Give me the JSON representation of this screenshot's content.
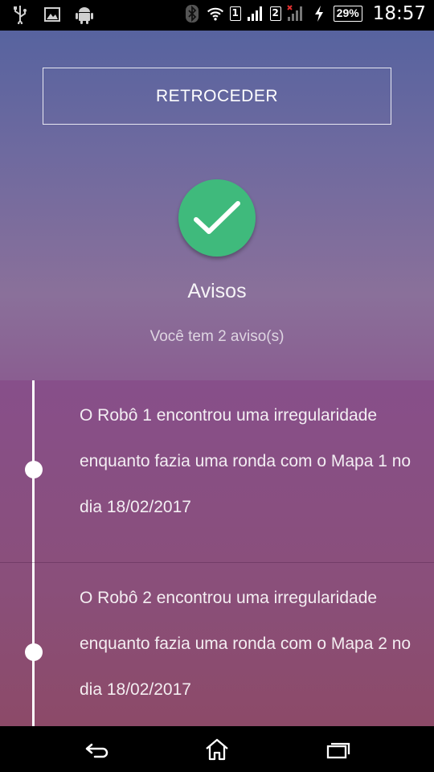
{
  "status_bar": {
    "sim1": "1",
    "sim2": "2",
    "battery": "29%",
    "time": "18:57"
  },
  "app": {
    "back_label": "RETROCEDER",
    "title": "Avisos",
    "subtitle": "Você tem 2 aviso(s)",
    "notices": [
      {
        "text": "O Robô 1 encontrou uma irregularidade enquanto fazia uma ronda com o Mapa 1 no dia 18/02/2017"
      },
      {
        "text": "O Robô 2 encontrou uma irregularidade enquanto fazia uma ronda com o Mapa 2 no dia 18/02/2017"
      }
    ]
  },
  "colors": {
    "check": "#3fba7c",
    "gradient_top": "#57639f",
    "gradient_bottom": "#875274"
  },
  "icons": [
    "usb-icon",
    "gallery-icon",
    "android-icon",
    "bluetooth-icon",
    "wifi-icon",
    "signal-icon",
    "charging-icon",
    "check-icon",
    "back-icon",
    "home-icon",
    "recent-apps-icon"
  ]
}
